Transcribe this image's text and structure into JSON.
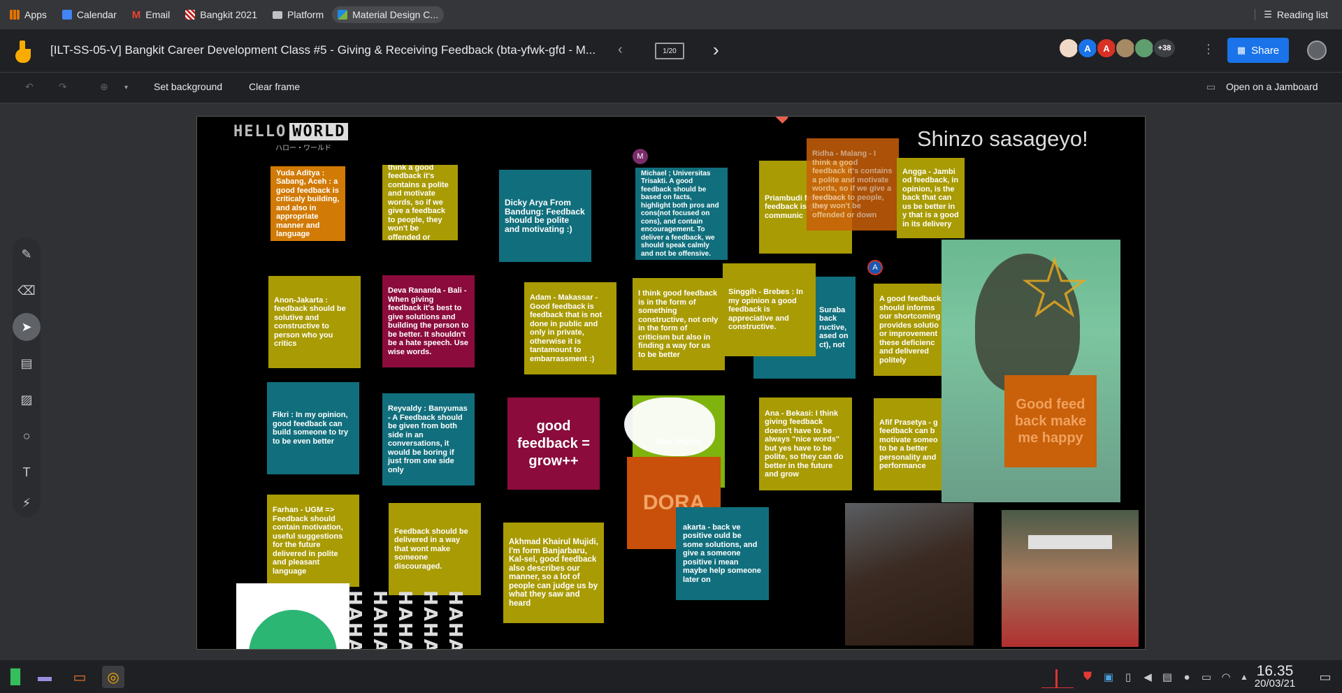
{
  "bookmarks": [
    {
      "label": "Apps",
      "icon": "apps-grid-icon",
      "color": "#e37400"
    },
    {
      "label": "Calendar",
      "icon": "calendar-icon",
      "color": "#4285f4"
    },
    {
      "label": "Email",
      "icon": "gmail-icon",
      "color": "#ea4335"
    },
    {
      "label": "Bangkit 2021",
      "icon": "bangkit-icon",
      "color": "#c5221f"
    },
    {
      "label": "Platform",
      "icon": "folder-icon",
      "color": "#bdc1c6"
    },
    {
      "label": "Material Design C...",
      "icon": "material-icon",
      "color": "#1e88e5"
    }
  ],
  "reading_list": "Reading list",
  "doc_title": "[ILT-SS-05-V] Bangkit Career Development Class #5 - Giving & Receiving Feedback (bta-yfwk-gfd - M...",
  "frame_counter": "1/20",
  "avatars": [
    "",
    "A",
    "A",
    "",
    ""
  ],
  "avatar_more": "+38",
  "share_label": "Share",
  "toolbar": {
    "set_background": "Set background",
    "clear_frame": "Clear frame",
    "open_jamboard": "Open on a Jamboard"
  },
  "board": {
    "hello": "HELLO",
    "world": "WORLD",
    "hello_sub": "ハロー・ワールド",
    "shinzo": "Shinzo sasageyo!",
    "notes": [
      "Yuda Aditya : Sabang, Aceh : a good feedback is criticaly building, and also in appropriate manner and language",
      "Ridha - Malang - I think a good feedback it's contains a polite and motivate words, so if we give a feedback to people, they won't be offended or down",
      "Dicky Arya From Bandung: Feedback should be polite and motivating :)",
      "Michael ; Universitas Trisakti. A good feedback should be based on facts, highlight both pros and cons(not focused on cons), and contain encouragement. To deliver a feedback, we should speak calmly and not be offensive.",
      "Priambudi from Garut feedback is good communic",
      "Ridha - Malang - I think a good feedback it's contains a polite and motivate words, so if we give a feedback to people, they won't be offended or down",
      "Angga - Jambi od feedback, in opinion, is the back that can us be better in y that is a good in its delivery",
      "Anon-Jakarta : feedback should be solutive and constructive to person who you critics",
      "Deva Rananda - Bali - When giving feedback it's best to give solutions and building the person to be better. It shouldn't be a hate speech. Use wise words.",
      "Adam - Makassar - Good feedback is feedback that is not done in public and only in private, otherwise it is tantamount to embarrassment :)",
      "I think good feedback is in the form of something constructive, not only in the form of criticism but also in finding a way for us to be better",
      "Singgih - Brebes : In my opinion a good feedback is appreciative and constructive.",
      "Suraba back ructive, ased on ct), not",
      "A good feedback should informs our shortcoming provides solutio or improvement these deficienc and delivered politely",
      "Fikri : In my opinion, good feedback can build someone to try to be even better",
      "Reyvaldy : Banyumas - A Feedback should be given from both side in an conversations, it would be boring if just from one side only",
      "good feedback = grow++",
      "Jakar improv",
      "Ana - Bekasi: I think giving feedback doesn't have to be always \"nice words\" but yes have to be polite, so they can do better in the future and grow",
      "Afif Prasetya - g feedback can b motivate someo to be a better personality and performance",
      "Good feed back make me happy",
      "DORA",
      "Farhan - UGM => Feedback should contain motivation, useful suggestions for the future delivered in polite and pleasant language",
      "Feedback should be delivered in a way that wont make someone discouraged.",
      "Akhmad Khairul Mujidi, I'm form Banjarbaru, Kal-sel, good feedback also describes our manner, so a lot of people can judge us by what they saw and heard",
      "akarta - back ve positive ould be some solutions, and give a someone positive i mean maybe help someone later on"
    ],
    "haha": "HAHAHA",
    "marker_m": "M",
    "marker_a": "A"
  },
  "clock": {
    "time": "16.35",
    "date": "20/03/21"
  }
}
